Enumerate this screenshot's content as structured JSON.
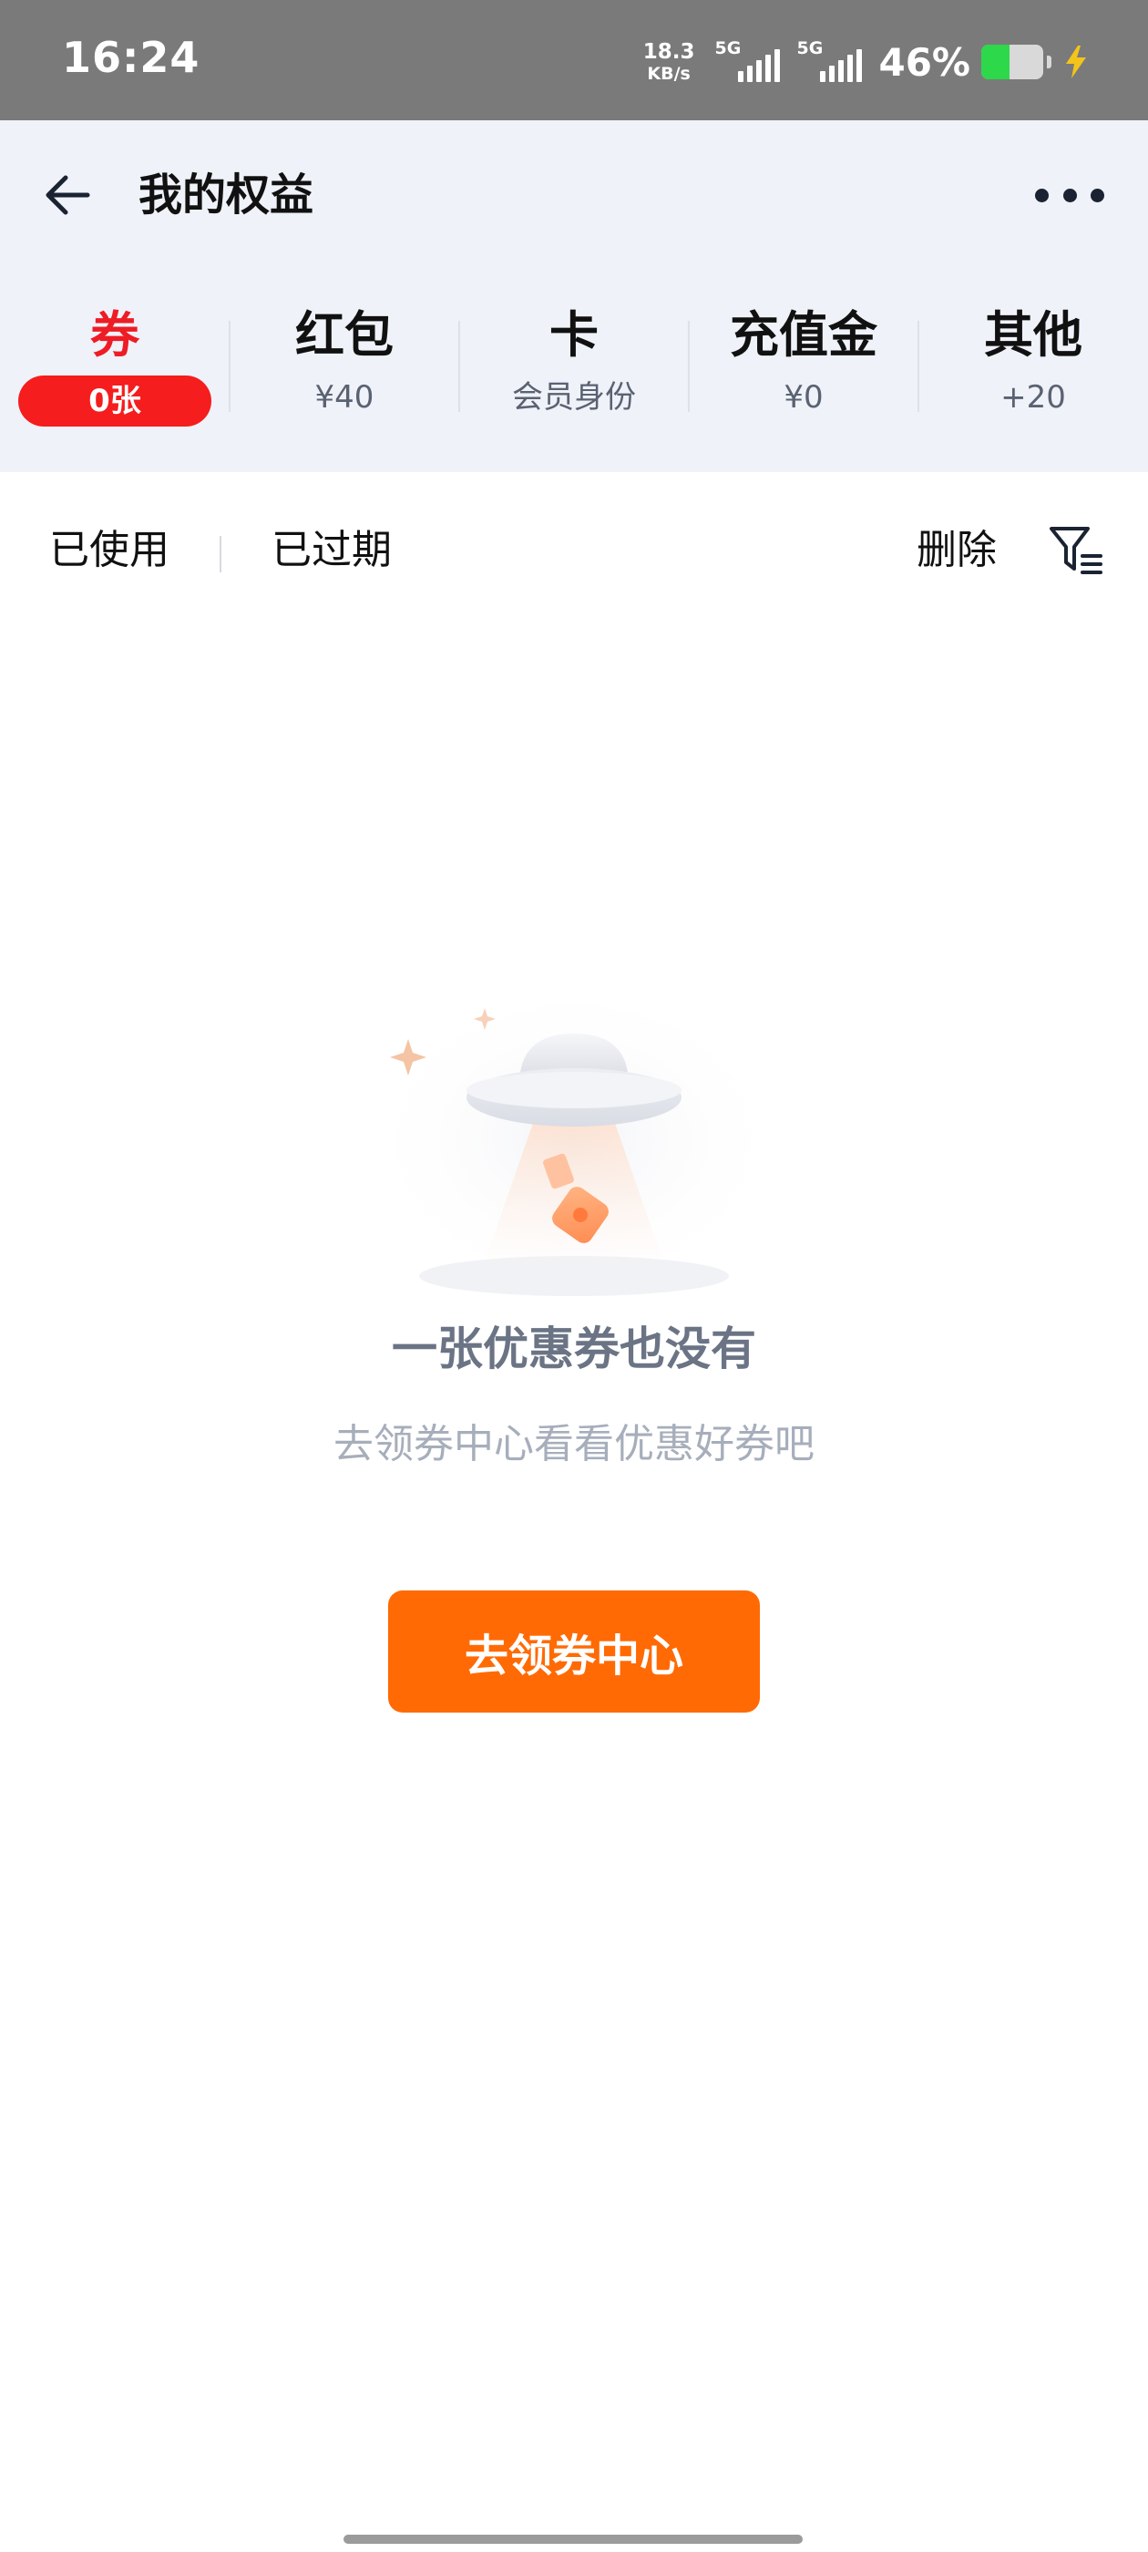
{
  "status_bar": {
    "time": "16:24",
    "net_speed": "18.3",
    "net_unit": "KB/s",
    "signal1_label": "5G",
    "signal2_label": "5G",
    "battery_pct": "46%",
    "battery_level": 0.46,
    "battery_color": "#2dd84a",
    "charging_icon": "bolt-icon"
  },
  "header": {
    "back_icon": "arrow-left-icon",
    "title": "我的权益",
    "more_icon": "more-dots-icon"
  },
  "tabs": [
    {
      "label": "券",
      "sub": "0张",
      "active": true
    },
    {
      "label": "红包",
      "sub": "¥40",
      "active": false
    },
    {
      "label": "卡",
      "sub": "会员身份",
      "active": false
    },
    {
      "label": "充值金",
      "sub": "¥0",
      "active": false
    },
    {
      "label": "其他",
      "sub": "+20",
      "active": false
    }
  ],
  "filters": {
    "used": "已使用",
    "expired": "已过期",
    "delete": "删除",
    "filter_icon": "filter-icon"
  },
  "empty_state": {
    "illustration": "ufo-coupon-illustration",
    "title": "一张优惠券也没有",
    "subtitle": "去领券中心看看优惠好券吧",
    "button_label": "去领券中心"
  },
  "colors": {
    "accent": "#ff6a04",
    "active_tab": "#ee1c25",
    "badge": "#f51d1d",
    "header_bg": "#eff2f8"
  }
}
